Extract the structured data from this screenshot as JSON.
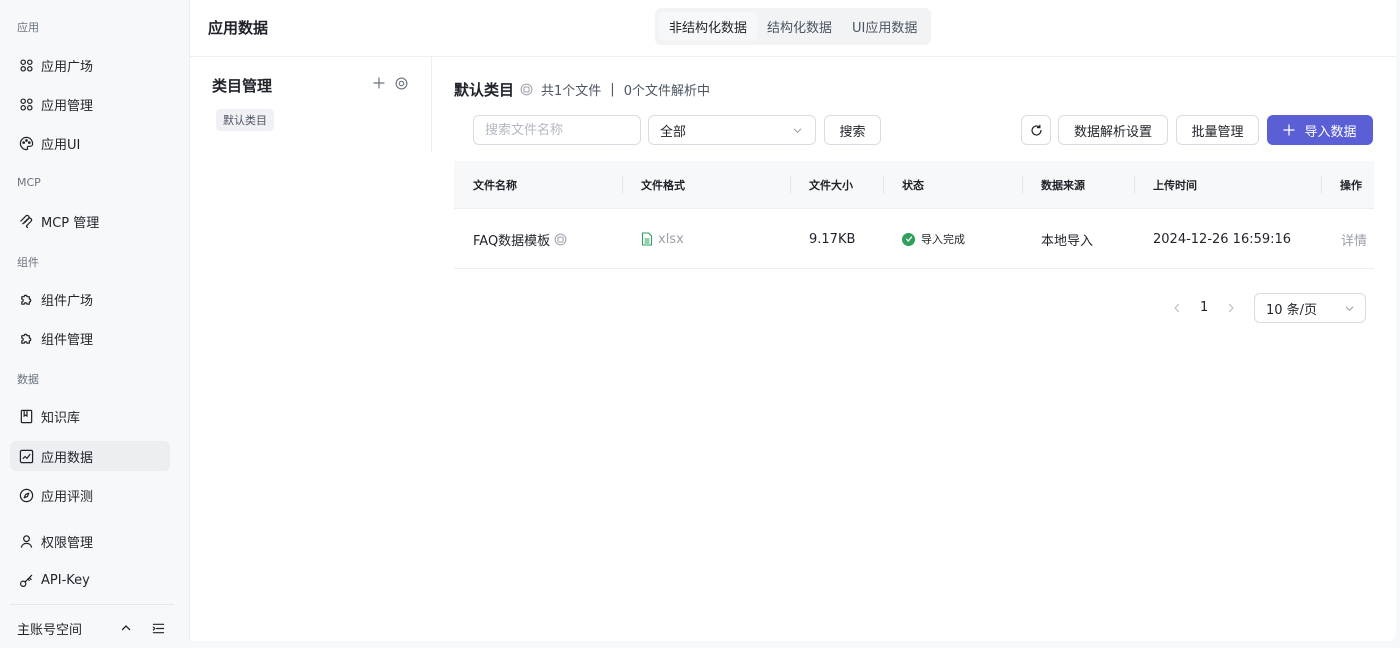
{
  "sidebar": {
    "groups": {
      "app": "应用",
      "mcp": "MCP",
      "component": "组件",
      "data": "数据"
    },
    "items": {
      "app_square": "应用广场",
      "app_manage": "应用管理",
      "app_ui": "应用UI",
      "mcp_manage": "MCP 管理",
      "comp_square": "组件广场",
      "comp_manage": "组件管理",
      "knowledge": "知识库",
      "app_data": "应用数据",
      "app_eval": "应用评测",
      "permission": "权限管理",
      "api_key": "API-Key"
    },
    "account": "主账号空间"
  },
  "header": {
    "title": "应用数据",
    "tabs": [
      "非结构化数据",
      "结构化数据",
      "UI应用数据"
    ],
    "active_tab": "非结构化数据"
  },
  "category": {
    "title": "类目管理",
    "chip": "默认类目"
  },
  "content": {
    "heading": "默认类目",
    "file_count": "共1个文件",
    "separator": "|",
    "parsing_count": "0个文件解析中",
    "search_placeholder": "搜索文件名称",
    "filter_value": "全部",
    "search_button": "搜索",
    "parse_settings_button": "数据解析设置",
    "batch_button": "批量管理",
    "import_button": "导入数据"
  },
  "table": {
    "columns": [
      "文件名称",
      "文件格式",
      "文件大小",
      "状态",
      "数据来源",
      "上传时间",
      "操作"
    ],
    "rows": [
      {
        "name": "FAQ数据模板",
        "format": "xlsx",
        "size": "9.17KB",
        "status": "导入完成",
        "source": "本地导入",
        "uploaded": "2024-12-26 16:59:16",
        "action": "详情"
      }
    ]
  },
  "pagination": {
    "current_page": "1",
    "page_size": "10 条/页"
  },
  "colors": {
    "primary": "#5b5fd6",
    "success": "#2e9f5d"
  }
}
